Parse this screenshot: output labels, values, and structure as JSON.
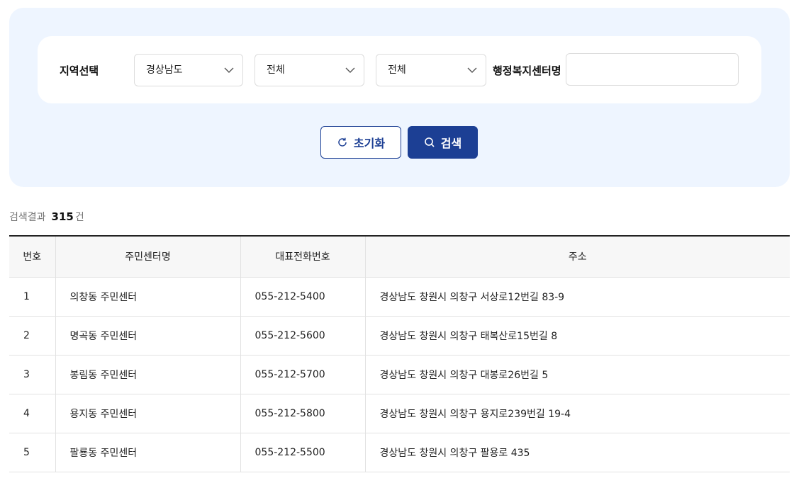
{
  "filters": {
    "region_label": "지역선택",
    "province": "경상남도",
    "city": "전체",
    "district": "전체",
    "center_name_label": "행정복지센터명",
    "center_name_value": "",
    "reset_label": "초기화",
    "search_label": "검색"
  },
  "results": {
    "label": "검색결과",
    "count": "315",
    "unit": "건"
  },
  "table": {
    "headers": [
      "번호",
      "주민센터명",
      "대표전화번호",
      "주소"
    ],
    "rows": [
      [
        "1",
        "의창동 주민센터",
        "055-212-5400",
        "경상남도 창원시 의창구 서상로12번길 83-9"
      ],
      [
        "2",
        "명곡동 주민센터",
        "055-212-5600",
        "경상남도 창원시 의창구 태복산로15번길 8"
      ],
      [
        "3",
        "봉림동 주민센터",
        "055-212-5700",
        "경상남도 창원시 의창구 대봉로26번길 5"
      ],
      [
        "4",
        "용지동 주민센터",
        "055-212-5800",
        "경상남도 창원시 의창구 용지로239번길 19-4"
      ],
      [
        "5",
        "팔룡동 주민센터",
        "055-212-5500",
        "경상남도 창원시 의창구 팔용로 435"
      ]
    ]
  },
  "colors": {
    "primary": "#1c3f94",
    "panel_bg": "#eef5ff"
  }
}
